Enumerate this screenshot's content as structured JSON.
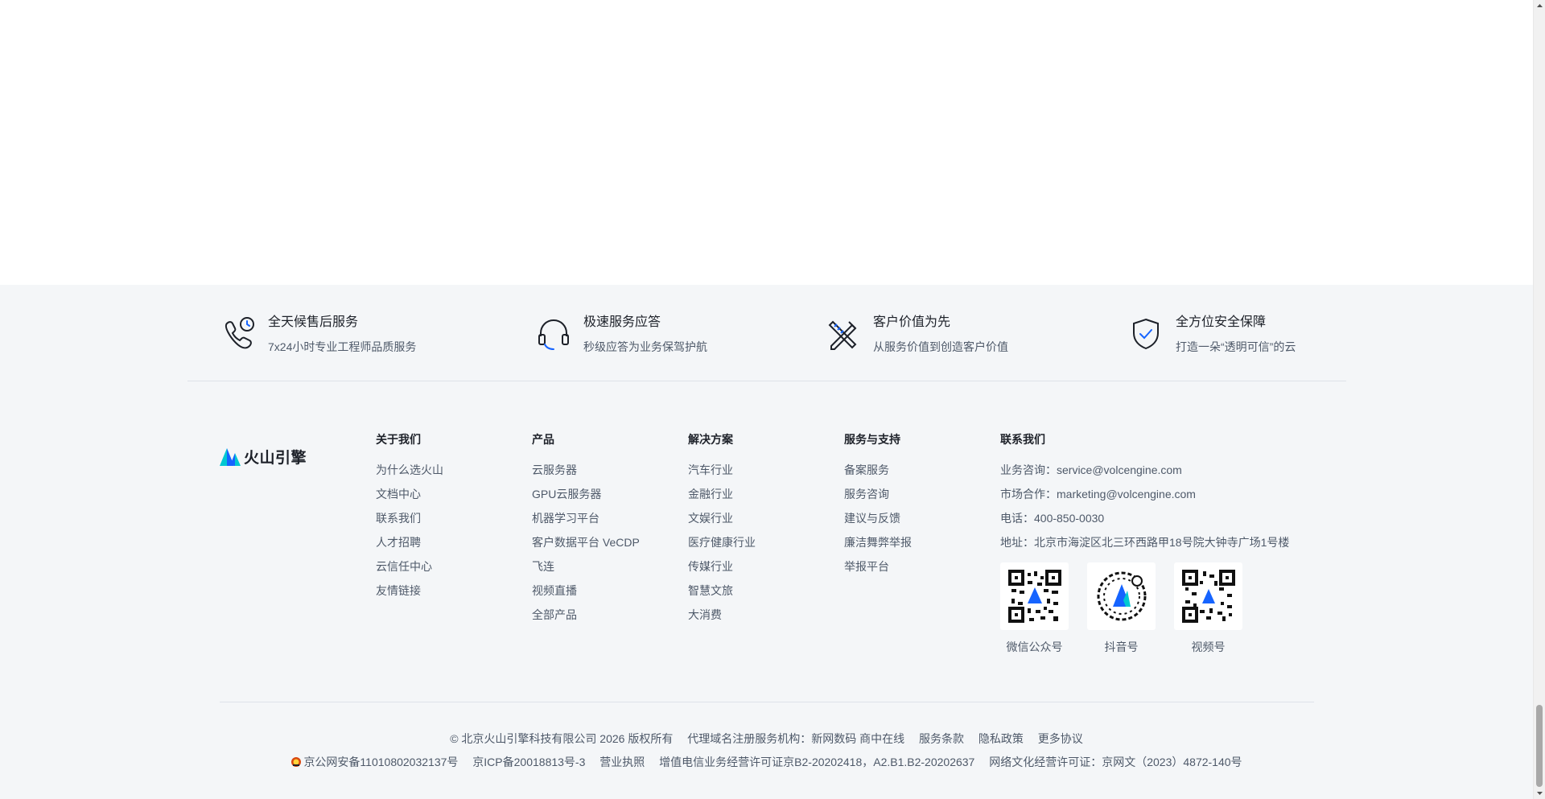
{
  "features": [
    {
      "icon": "phone-clock-icon",
      "title": "全天候售后服务",
      "desc": "7x24小时专业工程师品质服务"
    },
    {
      "icon": "headset-icon",
      "title": "极速服务应答",
      "desc": "秒级应答为业务保驾护航"
    },
    {
      "icon": "tools-icon",
      "title": "客户价值为先",
      "desc": "从服务价值到创造客户价值"
    },
    {
      "icon": "shield-check-icon",
      "title": "全方位安全保障",
      "desc": "打造一朵“透明可信”的云"
    }
  ],
  "brand": {
    "name": "火山引擎",
    "accent": "#1664ff"
  },
  "columns": {
    "about": {
      "title": "关于我们",
      "links": [
        "为什么选火山",
        "文档中心",
        "联系我们",
        "人才招聘",
        "云信任中心",
        "友情链接"
      ]
    },
    "products": {
      "title": "产品",
      "links": [
        "云服务器",
        "GPU云服务器",
        "机器学习平台",
        "客户数据平台 VeCDP",
        "飞连",
        "视频直播",
        "全部产品"
      ]
    },
    "solutions": {
      "title": "解决方案",
      "links": [
        "汽车行业",
        "金融行业",
        "文娱行业",
        "医疗健康行业",
        "传媒行业",
        "智慧文旅",
        "大消费"
      ]
    },
    "support": {
      "title": "服务与支持",
      "links": [
        "备案服务",
        "服务咨询",
        "建议与反馈",
        "廉洁舞弊举报",
        "举报平台"
      ]
    },
    "contact": {
      "title": "联系我们",
      "lines": [
        "业务咨询：service@volcengine.com",
        "市场合作：marketing@volcengine.com",
        "电话：400-850-0030",
        "地址：北京市海淀区北三环西路甲18号院大钟寺广场1号楼"
      ]
    }
  },
  "qrcodes": [
    "微信公众号",
    "抖音号",
    "视频号"
  ],
  "legal": {
    "copyright": "© 北京火山引擎科技有限公司 2026 版权所有",
    "registrar": "代理域名注册服务机构：新网数码 商中在线",
    "terms": "服务条款",
    "privacy": "隐私政策",
    "more": "更多协议",
    "police": "京公网安备11010802032137号",
    "icp": "京ICP备20018813号-3",
    "license": "营业执照",
    "telecom": "增值电信业务经营许可证京B2-20202418，A2.B1.B2-20202637",
    "culture": "网络文化经营许可证：京网文（2023）4872-140号"
  }
}
